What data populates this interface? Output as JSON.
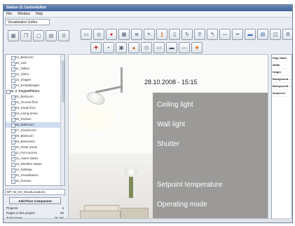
{
  "window": {
    "title": "Station 21 CarbonEditor"
  },
  "menubar": {
    "items": [
      "File",
      "Window",
      "Help"
    ]
  },
  "subtab": {
    "label": "Visualisation Editor"
  },
  "toolbar_left": {
    "icons": [
      "grid-icon",
      "copy-icon",
      "paste-icon",
      "layout-icon",
      "align-icon"
    ]
  },
  "toolbar_main": {
    "row1_icons": [
      "panel-icon",
      "group-icon",
      "record-icon",
      "grid-icon",
      "list-icon",
      "pointer-icon",
      "lamp-icon",
      "page-icon",
      "rotate-icon",
      "link-icon",
      "arrow-icon",
      "slider-icon",
      "bar-icon",
      "window-icon",
      "gallery-icon",
      "chart-icon",
      "settings-icon"
    ],
    "row2_icons": [
      "tag-icon",
      "dot-icon",
      "image-icon",
      "warning-icon",
      "clock-icon",
      "text-icon",
      "button-icon",
      "value-icon",
      "alert-icon"
    ]
  },
  "sidebar": {
    "tree_items": [
      {
        "label": "04_Bedroom",
        "type": "item"
      },
      {
        "label": "10_Link",
        "type": "item"
      },
      {
        "label": "11_Tables",
        "type": "item"
      },
      {
        "label": "12_Alarm",
        "type": "item"
      },
      {
        "label": "13_Images",
        "type": "item"
      },
      {
        "label": "14_Einstellungen",
        "type": "item"
      },
      {
        "label": "04_3_KeypadFloors",
        "type": "group"
      },
      {
        "label": "01_Bedroom",
        "type": "item"
      },
      {
        "label": "02_Ground floor",
        "type": "item"
      },
      {
        "label": "03_Study floor",
        "type": "item"
      },
      {
        "label": "04_Living areas",
        "type": "item"
      },
      {
        "label": "05_Kitchen",
        "type": "item"
      },
      {
        "label": "06_Bathroom",
        "type": "item",
        "selected": true
      },
      {
        "label": "07_Guestroom",
        "type": "item"
      },
      {
        "label": "08_Bedroom",
        "type": "item"
      },
      {
        "label": "09_Basement",
        "type": "item"
      },
      {
        "label": "10_Outer areas",
        "type": "item"
      },
      {
        "label": "11_First access",
        "type": "item"
      },
      {
        "label": "12_Alarm status",
        "type": "item"
      },
      {
        "label": "13_Weather status",
        "type": "item"
      },
      {
        "label": "14_Settings",
        "type": "item"
      },
      {
        "label": "15_Visualisation",
        "type": "item"
      },
      {
        "label": "16_Scenes",
        "type": "item"
      }
    ],
    "filter_value": "BP: 03_03_StructLocations",
    "add_button_label": "Add Floor Component",
    "stats": [
      {
        "label": "Projects",
        "value": "4"
      },
      {
        "label": "Pages in this project",
        "value": "60"
      },
      {
        "label": "Total pages",
        "value": "26 / 60"
      }
    ]
  },
  "canvas": {
    "datetime": "28.10.2008 - 15:15",
    "panel_labels": [
      "Ceiling light",
      "Wall light",
      "Shutter",
      "Setpoint temperature",
      "Operating mode"
    ]
  },
  "properties": {
    "rows": [
      "Page Name",
      "Width",
      "Height",
      "Background ...",
      "Background ...",
      "Sequence"
    ]
  }
}
